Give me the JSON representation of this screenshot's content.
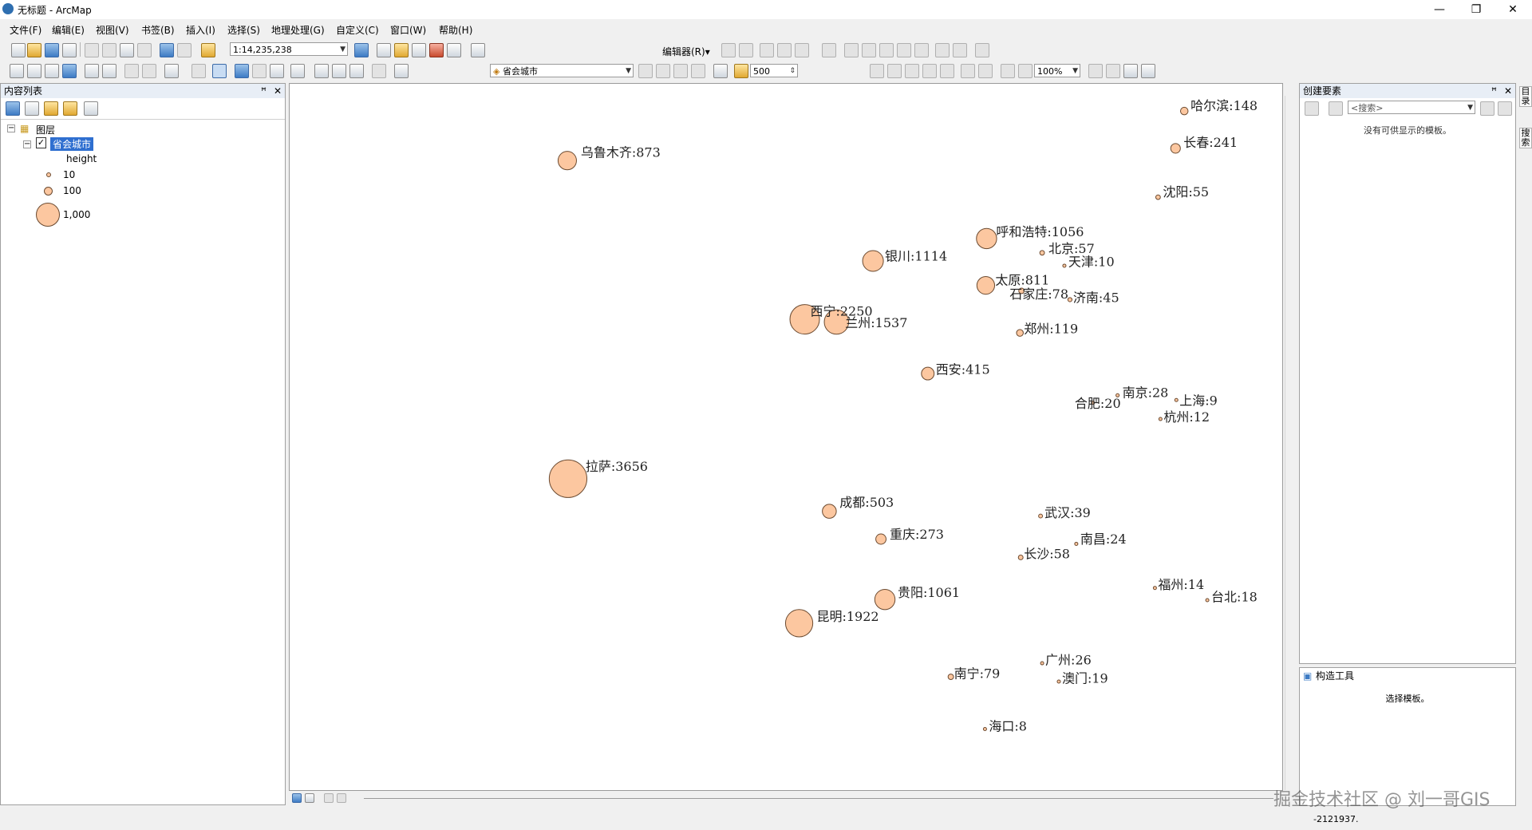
{
  "window": {
    "title": "无标题 - ArcMap",
    "controls": [
      "—",
      "❐",
      "✕"
    ]
  },
  "menu": [
    "文件(F)",
    "编辑(E)",
    "视图(V)",
    "书签(B)",
    "插入(I)",
    "选择(S)",
    "地理处理(G)",
    "自定义(C)",
    "窗口(W)",
    "帮助(H)"
  ],
  "toolbar": {
    "scale": "1:14,235,238",
    "editor_label": "编辑器(R)▾",
    "target_layer": "省会城市",
    "tolerance": "500",
    "zoom_percent": "100%"
  },
  "toc": {
    "title": "内容列表",
    "root_label": "图层",
    "layer_name": "省会城市",
    "field_name": "height",
    "legend": [
      {
        "label": "10",
        "size": "small"
      },
      {
        "label": "100",
        "size": "medium"
      },
      {
        "label": "1,000",
        "size": "large"
      }
    ]
  },
  "create_features": {
    "title": "创建要素",
    "search_placeholder": "<搜索>",
    "empty_message": "没有可供显示的模板。"
  },
  "construct_tools": {
    "title": "构造工具",
    "message": "选择模板。"
  },
  "side_tabs": [
    "目录",
    "搜索"
  ],
  "map": {
    "circle_fill": "#fcc7a0",
    "circle_stroke": "#6b4a30",
    "cities": [
      {
        "name": "乌鲁木齐",
        "value": 873,
        "label": "乌鲁木齐:873"
      },
      {
        "name": "哈尔滨",
        "value": 148,
        "label": "哈尔滨:148"
      },
      {
        "name": "长春",
        "value": 241,
        "label": "长春:241"
      },
      {
        "name": "沈阳",
        "value": 55,
        "label": "沈阳:55"
      },
      {
        "name": "呼和浩特",
        "value": 1056,
        "label": "呼和浩特:1056"
      },
      {
        "name": "北京",
        "value": 57,
        "label": "北京:57"
      },
      {
        "name": "天津",
        "value": 10,
        "label": "天津:10"
      },
      {
        "name": "银川",
        "value": 1114,
        "label": "银川:1114"
      },
      {
        "name": "太原",
        "value": 811,
        "label": "太原:811"
      },
      {
        "name": "石家庄",
        "value": 78,
        "label": "石家庄:78"
      },
      {
        "name": "济南",
        "value": 45,
        "label": "济南:45"
      },
      {
        "name": "西宁",
        "value": 2250,
        "label": "西宁:2250"
      },
      {
        "name": "兰州",
        "value": 1537,
        "label": "兰州:1537"
      },
      {
        "name": "郑州",
        "value": 119,
        "label": "郑州:119"
      },
      {
        "name": "西安",
        "value": 415,
        "label": "西安:415"
      },
      {
        "name": "南京",
        "value": 28,
        "label": "南京:28"
      },
      {
        "name": "合肥",
        "value": 20,
        "label": "合肥:20"
      },
      {
        "name": "上海",
        "value": 9,
        "label": "上海:9"
      },
      {
        "name": "杭州",
        "value": 12,
        "label": "杭州:12"
      },
      {
        "name": "拉萨",
        "value": 3656,
        "label": "拉萨:3656"
      },
      {
        "name": "成都",
        "value": 503,
        "label": "成都:503"
      },
      {
        "name": "武汉",
        "value": 39,
        "label": "武汉:39"
      },
      {
        "name": "重庆",
        "value": 273,
        "label": "重庆:273"
      },
      {
        "name": "南昌",
        "value": 24,
        "label": "南昌:24"
      },
      {
        "name": "长沙",
        "value": 58,
        "label": "长沙:58"
      },
      {
        "name": "贵阳",
        "value": 1061,
        "label": "贵阳:1061"
      },
      {
        "name": "福州",
        "value": 14,
        "label": "福州:14"
      },
      {
        "name": "台北",
        "value": 18,
        "label": "台北:18"
      },
      {
        "name": "昆明",
        "value": 1922,
        "label": "昆明:1922"
      },
      {
        "name": "广州",
        "value": 26,
        "label": "广州:26"
      },
      {
        "name": "南宁",
        "value": 79,
        "label": "南宁:79"
      },
      {
        "name": "澳门",
        "value": 19,
        "label": "澳门:19"
      },
      {
        "name": "海口",
        "value": 8,
        "label": "海口:8"
      }
    ]
  },
  "status": {
    "coordinates": "-2121937."
  },
  "watermark": "掘金技术社区 @ 刘一哥GIS"
}
